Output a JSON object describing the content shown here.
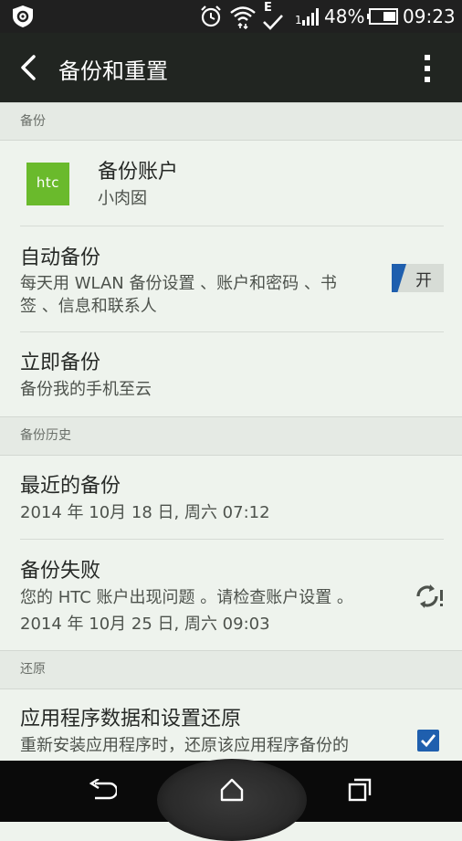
{
  "status_bar": {
    "battery_percent": "48%",
    "time": "09:23",
    "network_type": "E",
    "signal_prefix": "1"
  },
  "app_bar": {
    "title": "备份和重置"
  },
  "sections": {
    "backup": "备份",
    "history": "备份历史",
    "restore": "还原"
  },
  "backup_account": {
    "logo_text": "htc",
    "title": "备份账户",
    "subtitle": "小肉囡"
  },
  "auto_backup": {
    "title": "自动备份",
    "subtitle_line1": "每天用 WLAN 备份设置 、账户和密码 、书",
    "subtitle_line2": "签 、信息和联系人",
    "toggle_label": "开",
    "enabled": true
  },
  "backup_now": {
    "title": "立即备份",
    "subtitle": "备份我的手机至云"
  },
  "recent_backup": {
    "title": "最近的备份",
    "date": "2014 年 10月 18 日, 周六 07:12"
  },
  "backup_failed": {
    "title": "备份失败",
    "message": "您的 HTC 账户出现问题 。请检查账户设置 。",
    "date": "2014 年 10月 25 日, 周六 09:03",
    "icon": "sync-error-icon"
  },
  "app_restore": {
    "title": "应用程序数据和设置还原",
    "subtitle": "重新安装应用程序时，还原该应用程序备份的",
    "checked": true
  },
  "colors": {
    "accent": "#1f5fae",
    "htc_green": "#6aba2c",
    "app_bar": "#212521",
    "background": "#eef3ed"
  }
}
